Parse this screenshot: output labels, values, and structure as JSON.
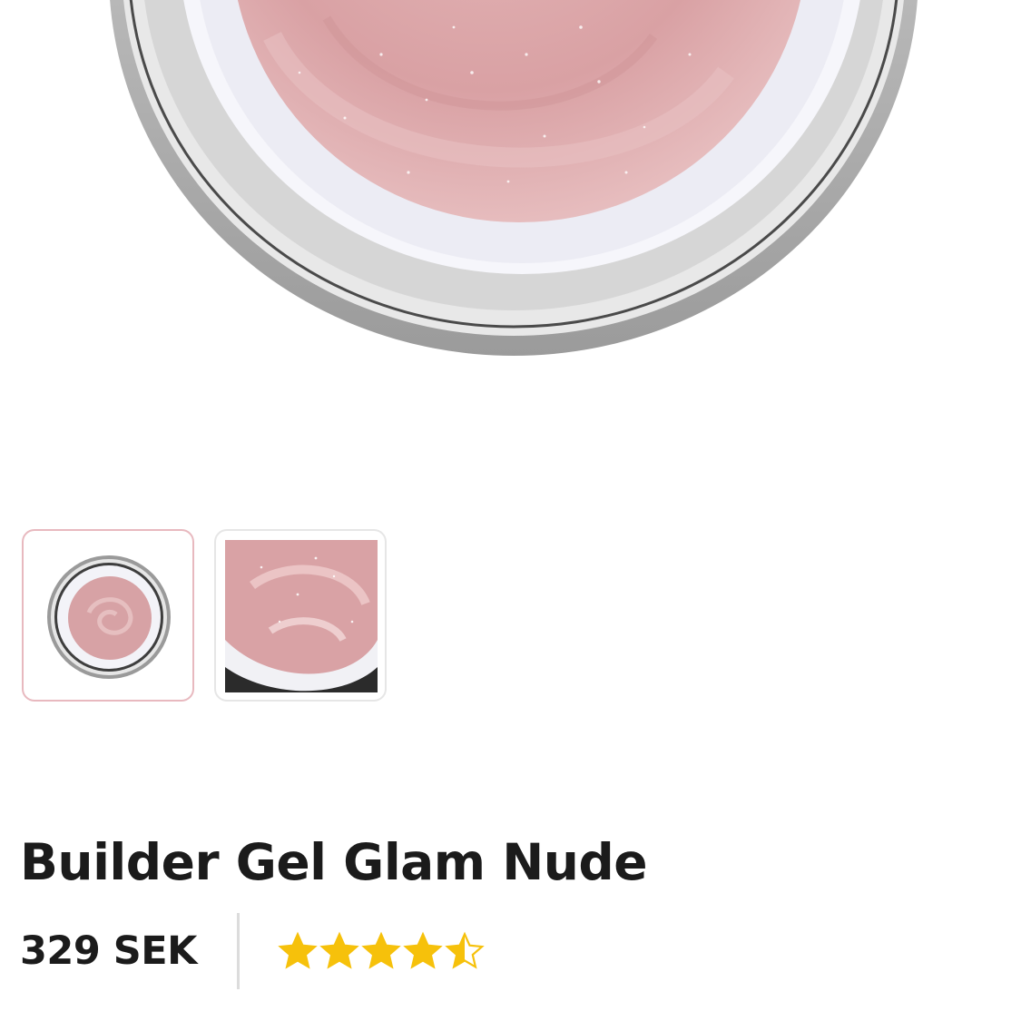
{
  "product": {
    "title": "Builder Gel Glam Nude",
    "price": "329 SEK",
    "rating": 4.5,
    "rating_max": 5
  },
  "gallery": {
    "main_image": "gel-jar-top-view",
    "thumbnails": [
      {
        "name": "jar-top-view",
        "active": true
      },
      {
        "name": "gel-closeup",
        "active": false
      }
    ]
  },
  "colors": {
    "gel_pink": "#d8a0a3",
    "star_fill": "#f6c10b",
    "star_empty": "#c8c8c8",
    "active_thumb_border": "#e8b9bf"
  }
}
